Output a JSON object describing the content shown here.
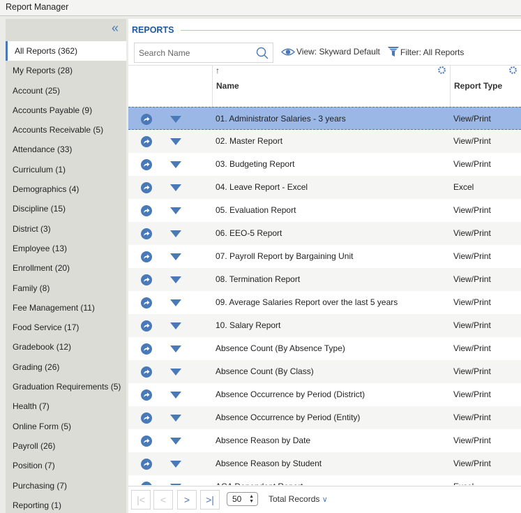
{
  "window": {
    "title": "Report Manager"
  },
  "sidebar": {
    "collapse_icon": "double-chevron-left-icon",
    "collapse_glyph": "«",
    "items": [
      {
        "label": "All Reports (362)",
        "active": true
      },
      {
        "label": "My Reports (28)"
      },
      {
        "label": "Account (25)"
      },
      {
        "label": "Accounts Payable (9)"
      },
      {
        "label": "Accounts Receivable (5)"
      },
      {
        "label": "Attendance (33)"
      },
      {
        "label": "Curriculum (1)"
      },
      {
        "label": "Demographics (4)"
      },
      {
        "label": "Discipline (15)"
      },
      {
        "label": "District (3)"
      },
      {
        "label": "Employee (13)"
      },
      {
        "label": "Enrollment (20)"
      },
      {
        "label": "Family (8)"
      },
      {
        "label": "Fee Management (11)"
      },
      {
        "label": "Food Service (17)"
      },
      {
        "label": "Gradebook (12)"
      },
      {
        "label": "Grading (26)"
      },
      {
        "label": "Graduation Requirements (5)"
      },
      {
        "label": "Health (7)"
      },
      {
        "label": "Online Form (5)"
      },
      {
        "label": "Payroll (26)"
      },
      {
        "label": "Position (7)"
      },
      {
        "label": "Purchasing (7)"
      },
      {
        "label": "Reporting (1)"
      }
    ]
  },
  "main": {
    "title": "REPORTS",
    "search": {
      "placeholder": "Search Name",
      "value": ""
    },
    "view_label": "View: Skyward Default",
    "filter_label": "Filter: All Reports",
    "columns": {
      "name": "Name",
      "type": "Report Type",
      "sort_glyph": "↑"
    },
    "accent": "#4a79b8",
    "selected_color": "#9ab7e6",
    "rows": [
      {
        "name": "01. Administrator Salaries - 3 years",
        "type": "View/Print",
        "selected": true
      },
      {
        "name": "02. Master Report",
        "type": "View/Print"
      },
      {
        "name": "03. Budgeting Report",
        "type": "View/Print"
      },
      {
        "name": "04. Leave Report - Excel",
        "type": "Excel"
      },
      {
        "name": "05. Evaluation Report",
        "type": "View/Print"
      },
      {
        "name": "06. EEO-5 Report",
        "type": "View/Print"
      },
      {
        "name": "07. Payroll Report by Bargaining Unit",
        "type": "View/Print"
      },
      {
        "name": "08. Termination Report",
        "type": "View/Print"
      },
      {
        "name": "09. Average Salaries Report over the last 5 years",
        "type": "View/Print"
      },
      {
        "name": "10. Salary Report",
        "type": "View/Print"
      },
      {
        "name": "Absence Count (By Absence Type)",
        "type": "View/Print"
      },
      {
        "name": "Absence Count (By Class)",
        "type": "View/Print"
      },
      {
        "name": "Absence Occurrence by Period (District)",
        "type": "View/Print"
      },
      {
        "name": "Absence Occurrence by Period (Entity)",
        "type": "View/Print"
      },
      {
        "name": "Absence Reason by Date",
        "type": "View/Print"
      },
      {
        "name": "Absence Reason by Student",
        "type": "View/Print"
      },
      {
        "name": "ACA Dependent Report",
        "type": "Excel"
      }
    ],
    "pager": {
      "first_glyph": "|<",
      "prev_glyph": "<",
      "next_glyph": ">",
      "last_glyph": ">|",
      "page_size": "50",
      "total_label": "Total Records",
      "total_chevron": "∨"
    }
  }
}
